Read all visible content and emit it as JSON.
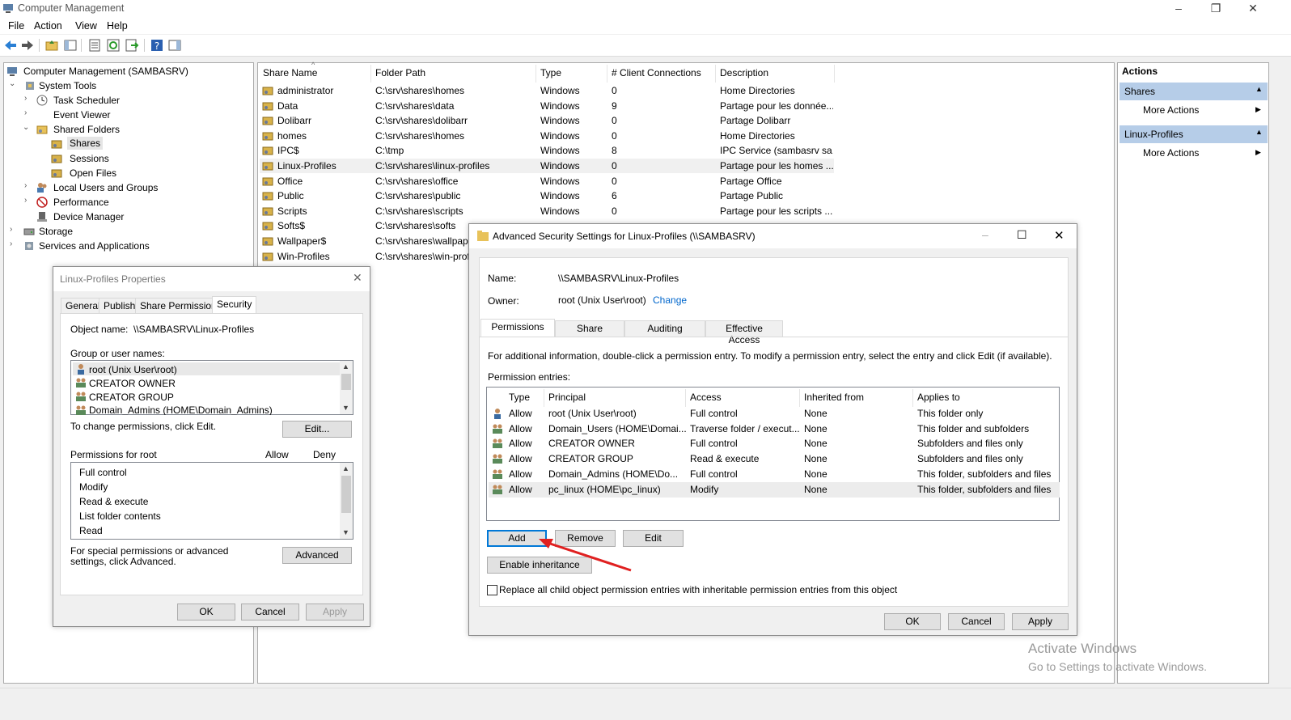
{
  "window": {
    "title": "Computer Management"
  },
  "menu": [
    "File",
    "Action",
    "View",
    "Help"
  ],
  "tree": {
    "root": "Computer Management (SAMBASRV)",
    "system_tools": "System Tools",
    "task_scheduler": "Task Scheduler",
    "event_viewer": "Event Viewer",
    "shared_folders": "Shared Folders",
    "shares": "Shares",
    "sessions": "Sessions",
    "open_files": "Open Files",
    "local_users": "Local Users and Groups",
    "performance": "Performance",
    "device_manager": "Device Manager",
    "storage": "Storage",
    "services": "Services and Applications"
  },
  "list": {
    "headers": [
      "Share Name",
      "Folder Path",
      "Type",
      "# Client Connections",
      "Description"
    ],
    "rows": [
      {
        "name": "administrator",
        "path": "C:\\srv\\shares\\homes",
        "type": "Windows",
        "conn": "0",
        "desc": "Home Directories"
      },
      {
        "name": "Data",
        "path": "C:\\srv\\shares\\data",
        "type": "Windows",
        "conn": "9",
        "desc": "Partage pour les donnée..."
      },
      {
        "name": "Dolibarr",
        "path": "C:\\srv\\shares\\dolibarr",
        "type": "Windows",
        "conn": "0",
        "desc": "Partage Dolibarr"
      },
      {
        "name": "homes",
        "path": "C:\\srv\\shares\\homes",
        "type": "Windows",
        "conn": "0",
        "desc": "Home Directories"
      },
      {
        "name": "IPC$",
        "path": "C:\\tmp",
        "type": "Windows",
        "conn": "8",
        "desc": "IPC Service (sambasrv sa..."
      },
      {
        "name": "Linux-Profiles",
        "path": "C:\\srv\\shares\\linux-profiles",
        "type": "Windows",
        "conn": "0",
        "desc": "Partage pour les homes ..."
      },
      {
        "name": "Office",
        "path": "C:\\srv\\shares\\office",
        "type": "Windows",
        "conn": "0",
        "desc": "Partage Office"
      },
      {
        "name": "Public",
        "path": "C:\\srv\\shares\\public",
        "type": "Windows",
        "conn": "6",
        "desc": "Partage Public"
      },
      {
        "name": "Scripts",
        "path": "C:\\srv\\shares\\scripts",
        "type": "Windows",
        "conn": "0",
        "desc": "Partage pour les scripts ..."
      },
      {
        "name": "Softs$",
        "path": "C:\\srv\\shares\\softs",
        "type": "",
        "conn": "",
        "desc": ""
      },
      {
        "name": "Wallpaper$",
        "path": "C:\\srv\\shares\\wallpape",
        "type": "",
        "conn": "",
        "desc": ""
      },
      {
        "name": "Win-Profiles",
        "path": "C:\\srv\\shares\\win-prof",
        "type": "",
        "conn": "",
        "desc": ""
      }
    ]
  },
  "actions": {
    "title": "Actions",
    "group1": "Shares",
    "more1": "More Actions",
    "group2": "Linux-Profiles",
    "more2": "More Actions"
  },
  "props": {
    "title": "Linux-Profiles Properties",
    "tabs": [
      "General",
      "Publish",
      "Share Permissions",
      "Security"
    ],
    "object_label": "Object name:",
    "object_value": "\\\\SAMBASRV\\Linux-Profiles",
    "group_label": "Group or user names:",
    "users": [
      "root (Unix User\\root)",
      "CREATOR OWNER",
      "CREATOR GROUP",
      "Domain_Admins (HOME\\Domain_Admins)"
    ],
    "change_text": "To change permissions, click Edit.",
    "edit": "Edit...",
    "perm_for": "Permissions for root",
    "allow": "Allow",
    "deny": "Deny",
    "perms": [
      "Full control",
      "Modify",
      "Read & execute",
      "List folder contents",
      "Read"
    ],
    "special_text": "For special permissions or advanced settings, click Advanced.",
    "advanced": "Advanced",
    "ok": "OK",
    "cancel": "Cancel",
    "apply": "Apply"
  },
  "adv": {
    "title": "Advanced Security Settings for Linux-Profiles (\\\\SAMBASRV)",
    "name_label": "Name:",
    "name_value": "\\\\SAMBASRV\\Linux-Profiles",
    "owner_label": "Owner:",
    "owner_value": "root (Unix User\\root)",
    "change": "Change",
    "tabs": [
      "Permissions",
      "Share",
      "Auditing",
      "Effective Access"
    ],
    "info": "For additional information, double-click a permission entry. To modify a permission entry, select the entry and click Edit (if available).",
    "entries_label": "Permission entries:",
    "headers": [
      "Type",
      "Principal",
      "Access",
      "Inherited from",
      "Applies to"
    ],
    "rows": [
      {
        "type": "Allow",
        "principal": "root (Unix User\\root)",
        "access": "Full control",
        "inherited": "None",
        "applies": "This folder only"
      },
      {
        "type": "Allow",
        "principal": "Domain_Users (HOME\\Domai...",
        "access": "Traverse folder / execut...",
        "inherited": "None",
        "applies": "This folder and subfolders"
      },
      {
        "type": "Allow",
        "principal": "CREATOR OWNER",
        "access": "Full control",
        "inherited": "None",
        "applies": "Subfolders and files only"
      },
      {
        "type": "Allow",
        "principal": "CREATOR GROUP",
        "access": "Read & execute",
        "inherited": "None",
        "applies": "Subfolders and files only"
      },
      {
        "type": "Allow",
        "principal": "Domain_Admins (HOME\\Do...",
        "access": "Full control",
        "inherited": "None",
        "applies": "This folder, subfolders and files"
      },
      {
        "type": "Allow",
        "principal": "pc_linux (HOME\\pc_linux)",
        "access": "Modify",
        "inherited": "None",
        "applies": "This folder, subfolders and files"
      }
    ],
    "add": "Add",
    "remove": "Remove",
    "edit": "Edit",
    "enable_inheritance": "Enable inheritance",
    "replace_text": "Replace all child object permission entries with inheritable permission entries from this object",
    "ok": "OK",
    "cancel": "Cancel",
    "apply": "Apply"
  },
  "watermark": {
    "line1": "Activate Windows",
    "line2": "Go to Settings to activate Windows."
  },
  "colors": {
    "accent": "#0078d7",
    "arrow": "#e02020",
    "action_header": "#b6cde8"
  }
}
